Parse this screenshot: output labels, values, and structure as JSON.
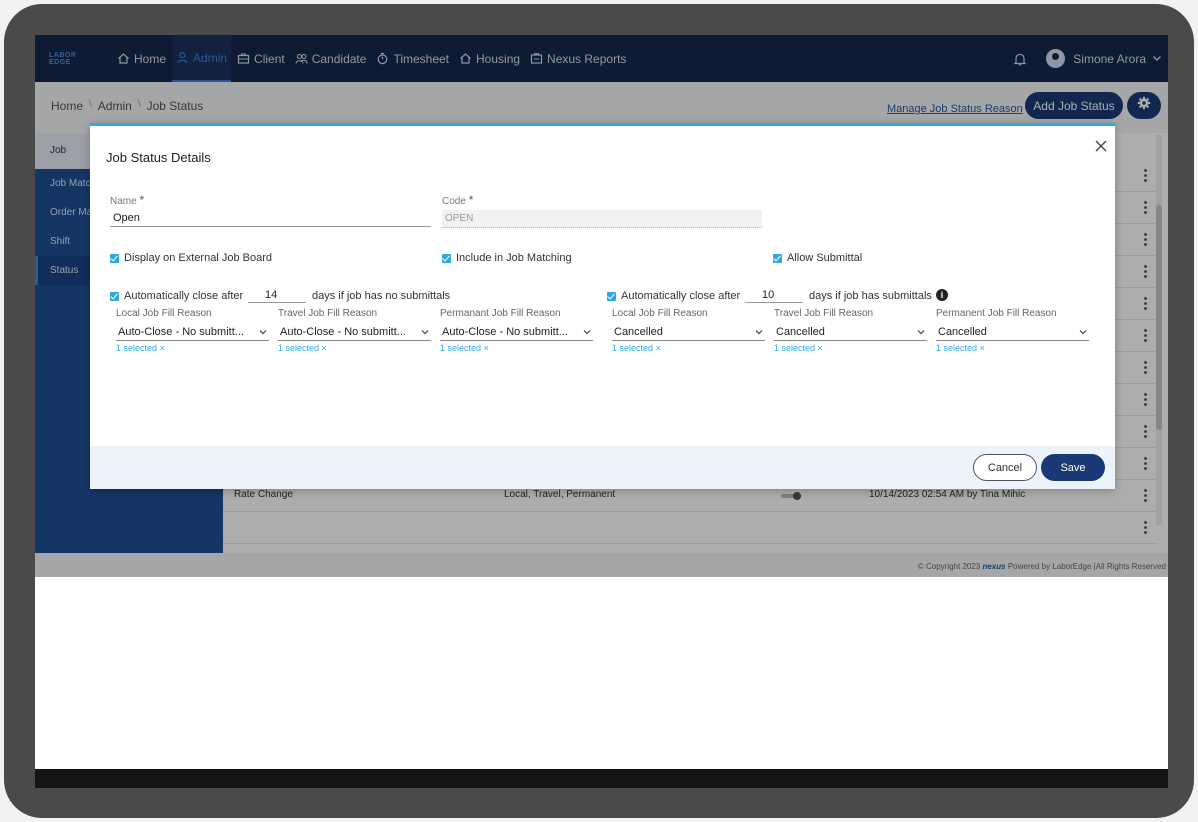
{
  "nav": {
    "logo": "LABOR EDGE",
    "items": [
      {
        "label": "Home",
        "icon": "home-icon"
      },
      {
        "label": "Admin",
        "icon": "user-icon"
      },
      {
        "label": "Client",
        "icon": "briefcase-icon"
      },
      {
        "label": "Candidate",
        "icon": "people-icon"
      },
      {
        "label": "Timesheet",
        "icon": "stopwatch-icon"
      },
      {
        "label": "Housing",
        "icon": "house-icon"
      },
      {
        "label": "Nexus Reports",
        "icon": "report-icon"
      }
    ],
    "active": "Admin",
    "user_name": "Simone Arora"
  },
  "breadcrumb": [
    "Home",
    "Admin",
    "Job Status"
  ],
  "toolbar": {
    "manage_link": "Manage Job Status Reason",
    "add_button": "Add Job Status"
  },
  "sidebar": {
    "items": [
      "Job",
      "Job Match",
      "Order Ma",
      "Shift",
      "Status"
    ],
    "active": "Status"
  },
  "table": {
    "visible_row": {
      "name": "Rate Change",
      "types": "Local, Travel, Permanent",
      "modified": "10/14/2023 02:54 AM by Tina Mihic"
    }
  },
  "footer": {
    "copyright": "© Copyright 2023",
    "brand": "nexus",
    "powered": "Powered by LaborEdge |All Rights Reserved"
  },
  "modal": {
    "title": "Job Status Details",
    "name_label": "Name",
    "name_value": "Open",
    "code_label": "Code",
    "code_value": "OPEN",
    "display_external": "Display on External Job Board",
    "include_matching": "Include in Job Matching",
    "allow_submittal": "Allow Submittal",
    "no_sub": {
      "prefix": "Automatically close after",
      "days": "14",
      "suffix": "days if job has no submittals",
      "reasons": [
        {
          "label": "Local Job Fill Reason",
          "value": "Auto-Close - No submitt...",
          "note": "1 selected"
        },
        {
          "label": "Travel Job Fill Reason",
          "value": "Auto-Close - No submitt...",
          "note": "1 selected"
        },
        {
          "label": "Permanant Job Fill Reason",
          "value": "Auto-Close - No submitt...",
          "note": "1 selected"
        }
      ]
    },
    "has_sub": {
      "prefix": "Automatically close after",
      "days": "10",
      "suffix": "days if job has submittals",
      "reasons": [
        {
          "label": "Local Job Fill Reason",
          "value": "Cancelled",
          "note": "1 selected"
        },
        {
          "label": "Travel Job Fill Reason",
          "value": "Cancelled",
          "note": "1 selected"
        },
        {
          "label": "Permanent Job Fill Reason",
          "value": "Cancelled",
          "note": "1 selected"
        }
      ]
    },
    "cancel_label": "Cancel",
    "save_label": "Save"
  },
  "colors": {
    "nav_bg": "#16284f",
    "accent": "#2ea9e6",
    "primary_button": "#1b3a75",
    "sidebar_bg": "#1f4f95"
  }
}
